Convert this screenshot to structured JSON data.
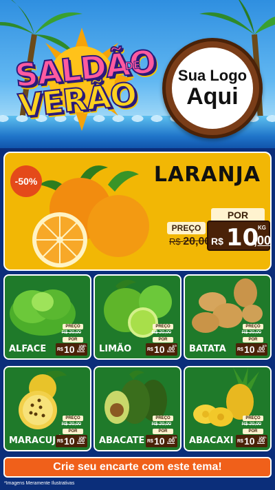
{
  "header": {
    "title_line1": "SALDÃO",
    "title_line2": "VERÃO",
    "title_de": "DE",
    "logo_line1": "Sua Logo",
    "logo_line2": "Aqui"
  },
  "featured": {
    "name": "LARANJA",
    "discount": "-50%",
    "por_label": "POR",
    "preco_label": "PREÇO",
    "old_currency": "R$",
    "old_price": "20,00",
    "currency": "R$",
    "price_int": "10",
    "price_dec": ",00",
    "unit": "KG"
  },
  "products": [
    {
      "name": "ALFACE",
      "preco_label": "PREÇO",
      "old_price": "R$ 20,00",
      "por_label": "POR",
      "currency": "R$",
      "price_int": "10",
      "price_dec": ",00",
      "unit": "UNID."
    },
    {
      "name": "LIMÃO",
      "preco_label": "PREÇO",
      "old_price": "R$ 20,00",
      "por_label": "POR",
      "currency": "R$",
      "price_int": "10",
      "price_dec": ",00",
      "unit": "KG"
    },
    {
      "name": "BATATA",
      "preco_label": "PREÇO",
      "old_price": "R$ 20,00",
      "por_label": "POR",
      "currency": "R$",
      "price_int": "10",
      "price_dec": ",00",
      "unit": "KG"
    },
    {
      "name": "MARACUJÁ",
      "preco_label": "PREÇO",
      "old_price": "R$ 20,00",
      "por_label": "POR",
      "currency": "R$",
      "price_int": "10",
      "price_dec": ",00",
      "unit": "UNID."
    },
    {
      "name": "ABACATE",
      "preco_label": "PREÇO",
      "old_price": "R$ 20,00",
      "por_label": "POR",
      "currency": "R$",
      "price_int": "10",
      "price_dec": ",00",
      "unit": "KG"
    },
    {
      "name": "ABACAXI",
      "preco_label": "PREÇO",
      "old_price": "R$ 20,00",
      "por_label": "POR",
      "currency": "R$",
      "price_int": "10",
      "price_dec": ",00",
      "unit": "UNID."
    }
  ],
  "cta": {
    "label": "Crie seu encarte com este tema!"
  },
  "disclaimer": "*Imagens Meramente Ilustrativas",
  "colors": {
    "sky": "#2f8fe0",
    "featured_bg": "#f2b705",
    "card_bg": "#1f7a2a",
    "price_bg": "#4a2208",
    "cta_bg": "#f0601a",
    "discount_bg": "#e44a1a"
  },
  "icons": [
    "sun-icon",
    "palm-tree-icon",
    "orange-icon",
    "lettuce-icon",
    "lime-icon",
    "potato-icon",
    "passion-fruit-icon",
    "avocado-icon",
    "pineapple-icon"
  ]
}
